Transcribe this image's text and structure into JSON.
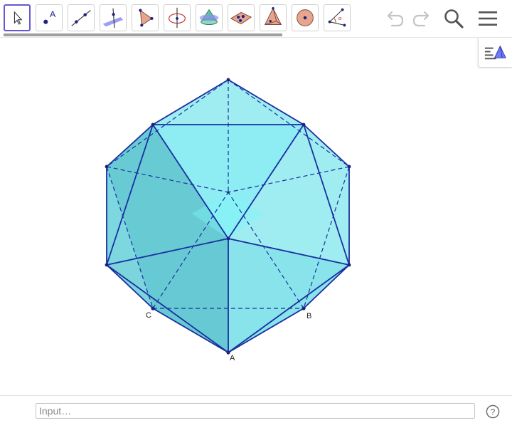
{
  "toolbar": {
    "tools": [
      {
        "name": "move-tool-icon",
        "selected": true
      },
      {
        "name": "point-tool-icon",
        "glyph": "A"
      },
      {
        "name": "line-tool-icon"
      },
      {
        "name": "perpendicular-line-tool-icon"
      },
      {
        "name": "polygon-tool-icon"
      },
      {
        "name": "circle-axis-tool-icon"
      },
      {
        "name": "pyramid-tool-icon"
      },
      {
        "name": "net-tool-icon"
      },
      {
        "name": "tetrahedron-tool-icon"
      },
      {
        "name": "sphere-tool-icon"
      },
      {
        "name": "angle-tool-icon",
        "glyph": "α"
      }
    ],
    "actions": [
      "undo-icon",
      "redo-icon",
      "search-icon",
      "menu-icon"
    ]
  },
  "graphics": {
    "points": [
      {
        "label": "A"
      },
      {
        "label": "B"
      },
      {
        "label": "C"
      }
    ],
    "colors": {
      "face": "#3fd9e4",
      "edge": "#1a2fa0",
      "point": "#1a237e"
    }
  },
  "input_bar": {
    "placeholder": "Input…",
    "help_glyph": "?"
  }
}
